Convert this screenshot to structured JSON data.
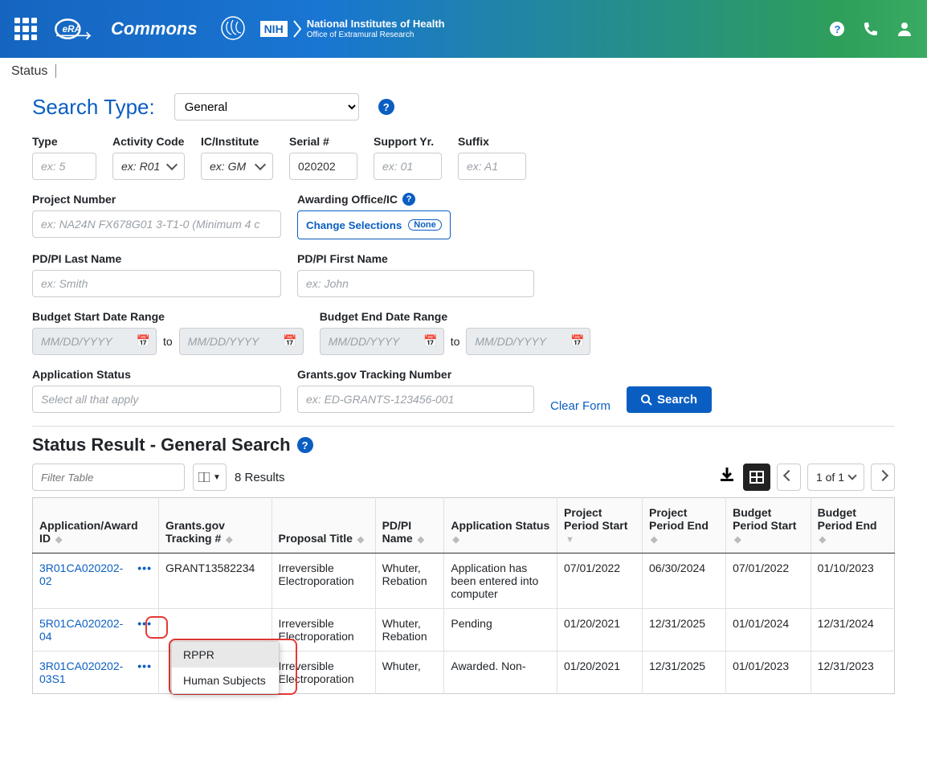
{
  "header": {
    "commons": "Commons",
    "nih_line1": "National Institutes of Health",
    "nih_line2": "Office of Extramural Research",
    "nih_box": "NIH"
  },
  "breadcrumb": "Status",
  "search": {
    "type_label": "Search Type:",
    "type_value": "General",
    "fields": {
      "type": {
        "label": "Type",
        "placeholder": "ex: 5"
      },
      "activity": {
        "label": "Activity Code",
        "placeholder": "ex: R01"
      },
      "ic": {
        "label": "IC/Institute",
        "placeholder": "ex: GM"
      },
      "serial": {
        "label": "Serial #",
        "placeholder": "",
        "value": "020202"
      },
      "support": {
        "label": "Support Yr.",
        "placeholder": "ex: 01"
      },
      "suffix": {
        "label": "Suffix",
        "placeholder": "ex: A1"
      },
      "project": {
        "label": "Project Number",
        "placeholder": "ex: NA24N FX678G01 3-T1-0 (Minimum 4 c"
      },
      "awarding": {
        "label": "Awarding Office/IC",
        "button": "Change Selections",
        "pill": "None"
      },
      "lastname": {
        "label": "PD/PI Last Name",
        "placeholder": "ex: Smith"
      },
      "firstname": {
        "label": "PD/PI First Name",
        "placeholder": "ex: John"
      },
      "budget_start": {
        "label": "Budget Start Date Range",
        "placeholder": "MM/DD/YYYY",
        "to": "to"
      },
      "budget_end": {
        "label": "Budget End Date Range",
        "placeholder": "MM/DD/YYYY",
        "to": "to"
      },
      "app_status": {
        "label": "Application Status",
        "placeholder": "Select all that apply"
      },
      "tracking": {
        "label": "Grants.gov Tracking Number",
        "placeholder": "ex: ED-GRANTS-123456-001"
      }
    },
    "clear": "Clear Form",
    "search_btn": "Search"
  },
  "results": {
    "title": "Status Result - General Search",
    "filter_placeholder": "Filter Table",
    "count": "8 Results",
    "page_label": "1 of 1",
    "columns": [
      "Application/Award ID",
      "Grants.gov Tracking #",
      "Proposal Title",
      "PD/PI Name",
      "Application Status",
      "Project Period Start",
      "Project Period End",
      "Budget Period Start",
      "Budget Period End"
    ],
    "rows": [
      {
        "id": "3R01CA020202-02",
        "tracking": "GRANT13582234",
        "title": "Irreversible Electroporation",
        "name": "Whuter, Rebation",
        "status": "Application has been entered into computer",
        "pps": "07/01/2022",
        "ppe": "06/30/2024",
        "bps": "07/01/2022",
        "bpe": "01/10/2023"
      },
      {
        "id": "5R01CA020202-04",
        "tracking": "",
        "title": "Irreversible Electroporation",
        "name": "Whuter, Rebation",
        "status": "Pending",
        "pps": "01/20/2021",
        "ppe": "12/31/2025",
        "bps": "01/01/2024",
        "bpe": "12/31/2024"
      },
      {
        "id": "3R01CA020202-03S1",
        "tracking": "",
        "title": "Irreversible Electroporation",
        "name": "Whuter,",
        "status": "Awarded. Non-",
        "pps": "01/20/2021",
        "ppe": "12/31/2025",
        "bps": "01/01/2023",
        "bpe": "12/31/2023"
      }
    ],
    "popup": {
      "item1": "RPPR",
      "item2": "Human Subjects"
    }
  }
}
